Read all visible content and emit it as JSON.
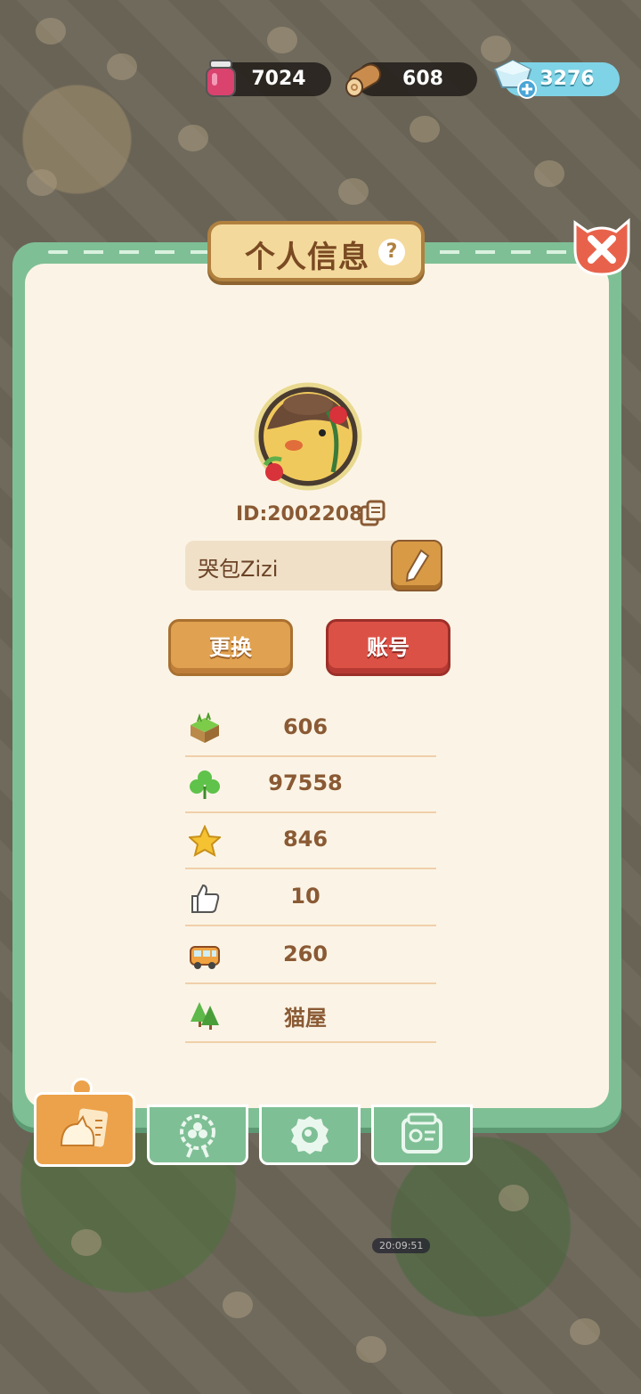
{
  "resources": {
    "jam": "7024",
    "wood": "608",
    "gems": "3276"
  },
  "panel": {
    "title": "个人信息",
    "help_glyph": "?"
  },
  "profile": {
    "id_text": "ID:20022087",
    "nickname": "哭包Zizi",
    "change_button": "更换",
    "account_button": "账号"
  },
  "stats": [
    {
      "icon": "grass-block-icon",
      "value": "606"
    },
    {
      "icon": "clover-icon",
      "value": "97558"
    },
    {
      "icon": "star-icon",
      "value": "846"
    },
    {
      "icon": "thumbs-up-icon",
      "value": "10"
    },
    {
      "icon": "bus-icon",
      "value": "260"
    },
    {
      "icon": "trees-icon",
      "value": "猫屋"
    }
  ],
  "tabs": [
    {
      "name": "profile-tab",
      "icon": "cat-card-icon",
      "active": true
    },
    {
      "name": "badge-tab",
      "icon": "clover-badge-icon",
      "active": false
    },
    {
      "name": "cookie-tab",
      "icon": "cookie-icon",
      "active": false
    },
    {
      "name": "album-tab",
      "icon": "photo-album-icon",
      "active": false
    }
  ],
  "colors": {
    "panel_green": "#7fbf95",
    "panel_bg": "#fbf4e6",
    "text_brown": "#8a5a34",
    "button_orange": "#e0a150",
    "button_red": "#dc5146",
    "close_red": "#e8624b"
  },
  "world": {
    "timer": "20:09:51"
  }
}
